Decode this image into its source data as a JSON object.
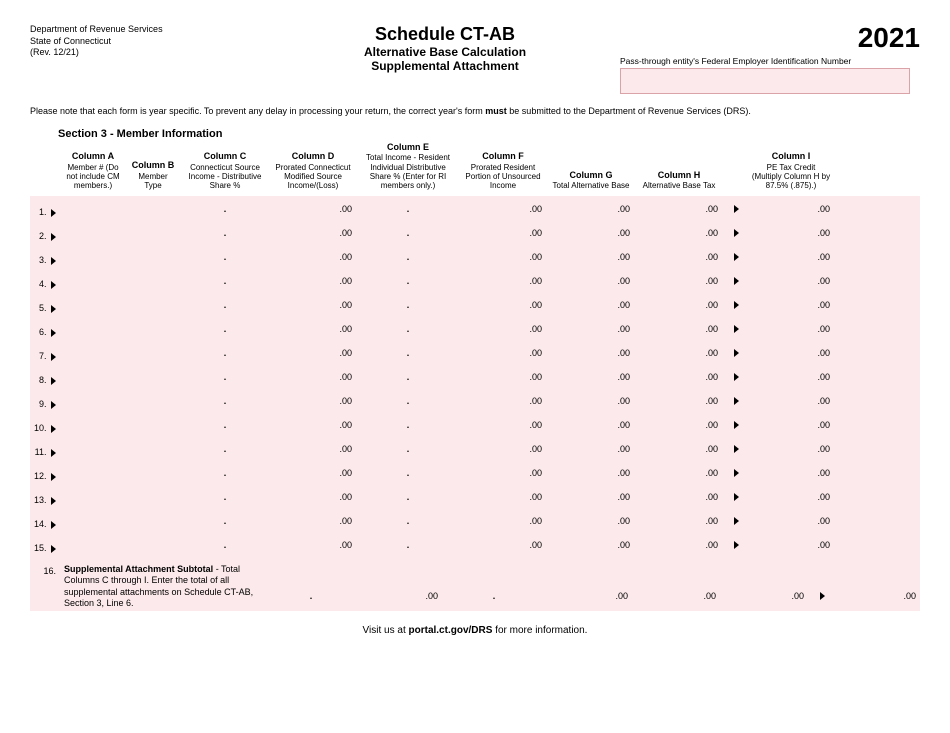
{
  "header": {
    "dept_line1": "Department of Revenue Services",
    "dept_line2": "State of Connecticut",
    "rev": "(Rev. 12/21)",
    "schedule_title": "Schedule CT-AB",
    "subtitle1": "Alternative Base Calculation",
    "subtitle2": "Supplemental Attachment",
    "year": "2021",
    "fein_label": "Pass-through entity's Federal Employer Identification Number"
  },
  "notice_pre": "Please note that each form is year specific. To prevent any delay in processing your return, the correct year's form ",
  "notice_bold": "must",
  "notice_post": " be submitted to the Department of Revenue Services (DRS).",
  "section_title": "Section 3 - Member Information",
  "columns": {
    "A": {
      "title": "Column A",
      "desc": "Member # (Do not include CM members.)"
    },
    "B": {
      "title": "Column B",
      "desc": "Member Type"
    },
    "C": {
      "title": "Column C",
      "desc": "Connecticut Source Income - Distributive Share %"
    },
    "D": {
      "title": "Column D",
      "desc": "Prorated Connecticut Modified Source Income/(Loss)"
    },
    "E": {
      "title": "Column E",
      "desc": "Total Income - Resident Individual Distributive Share % (Enter for RI members only.)"
    },
    "F": {
      "title": "Column F",
      "desc": "Prorated Resident Portion of Unsourced Income"
    },
    "G": {
      "title": "Column G",
      "desc": "Total Alternative Base"
    },
    "H": {
      "title": "Column H",
      "desc": "Alternative Base Tax"
    },
    "I": {
      "title": "Column I",
      "desc": "PE Tax Credit (Multiply Column H by 87.5% (.875).)"
    }
  },
  "row_count": 15,
  "suffix_dec": ".00",
  "dot": ".",
  "subtotal": {
    "num": "16.",
    "label_bold": "Supplemental Attachment Subtotal",
    "label_rest": " - Total Columns C through I. Enter the total of all supplemental attachments on Schedule CT-AB, Section 3, Line 6."
  },
  "footer_pre": "Visit us at ",
  "footer_bold": "portal.ct.gov/DRS",
  "footer_post": " for more information."
}
